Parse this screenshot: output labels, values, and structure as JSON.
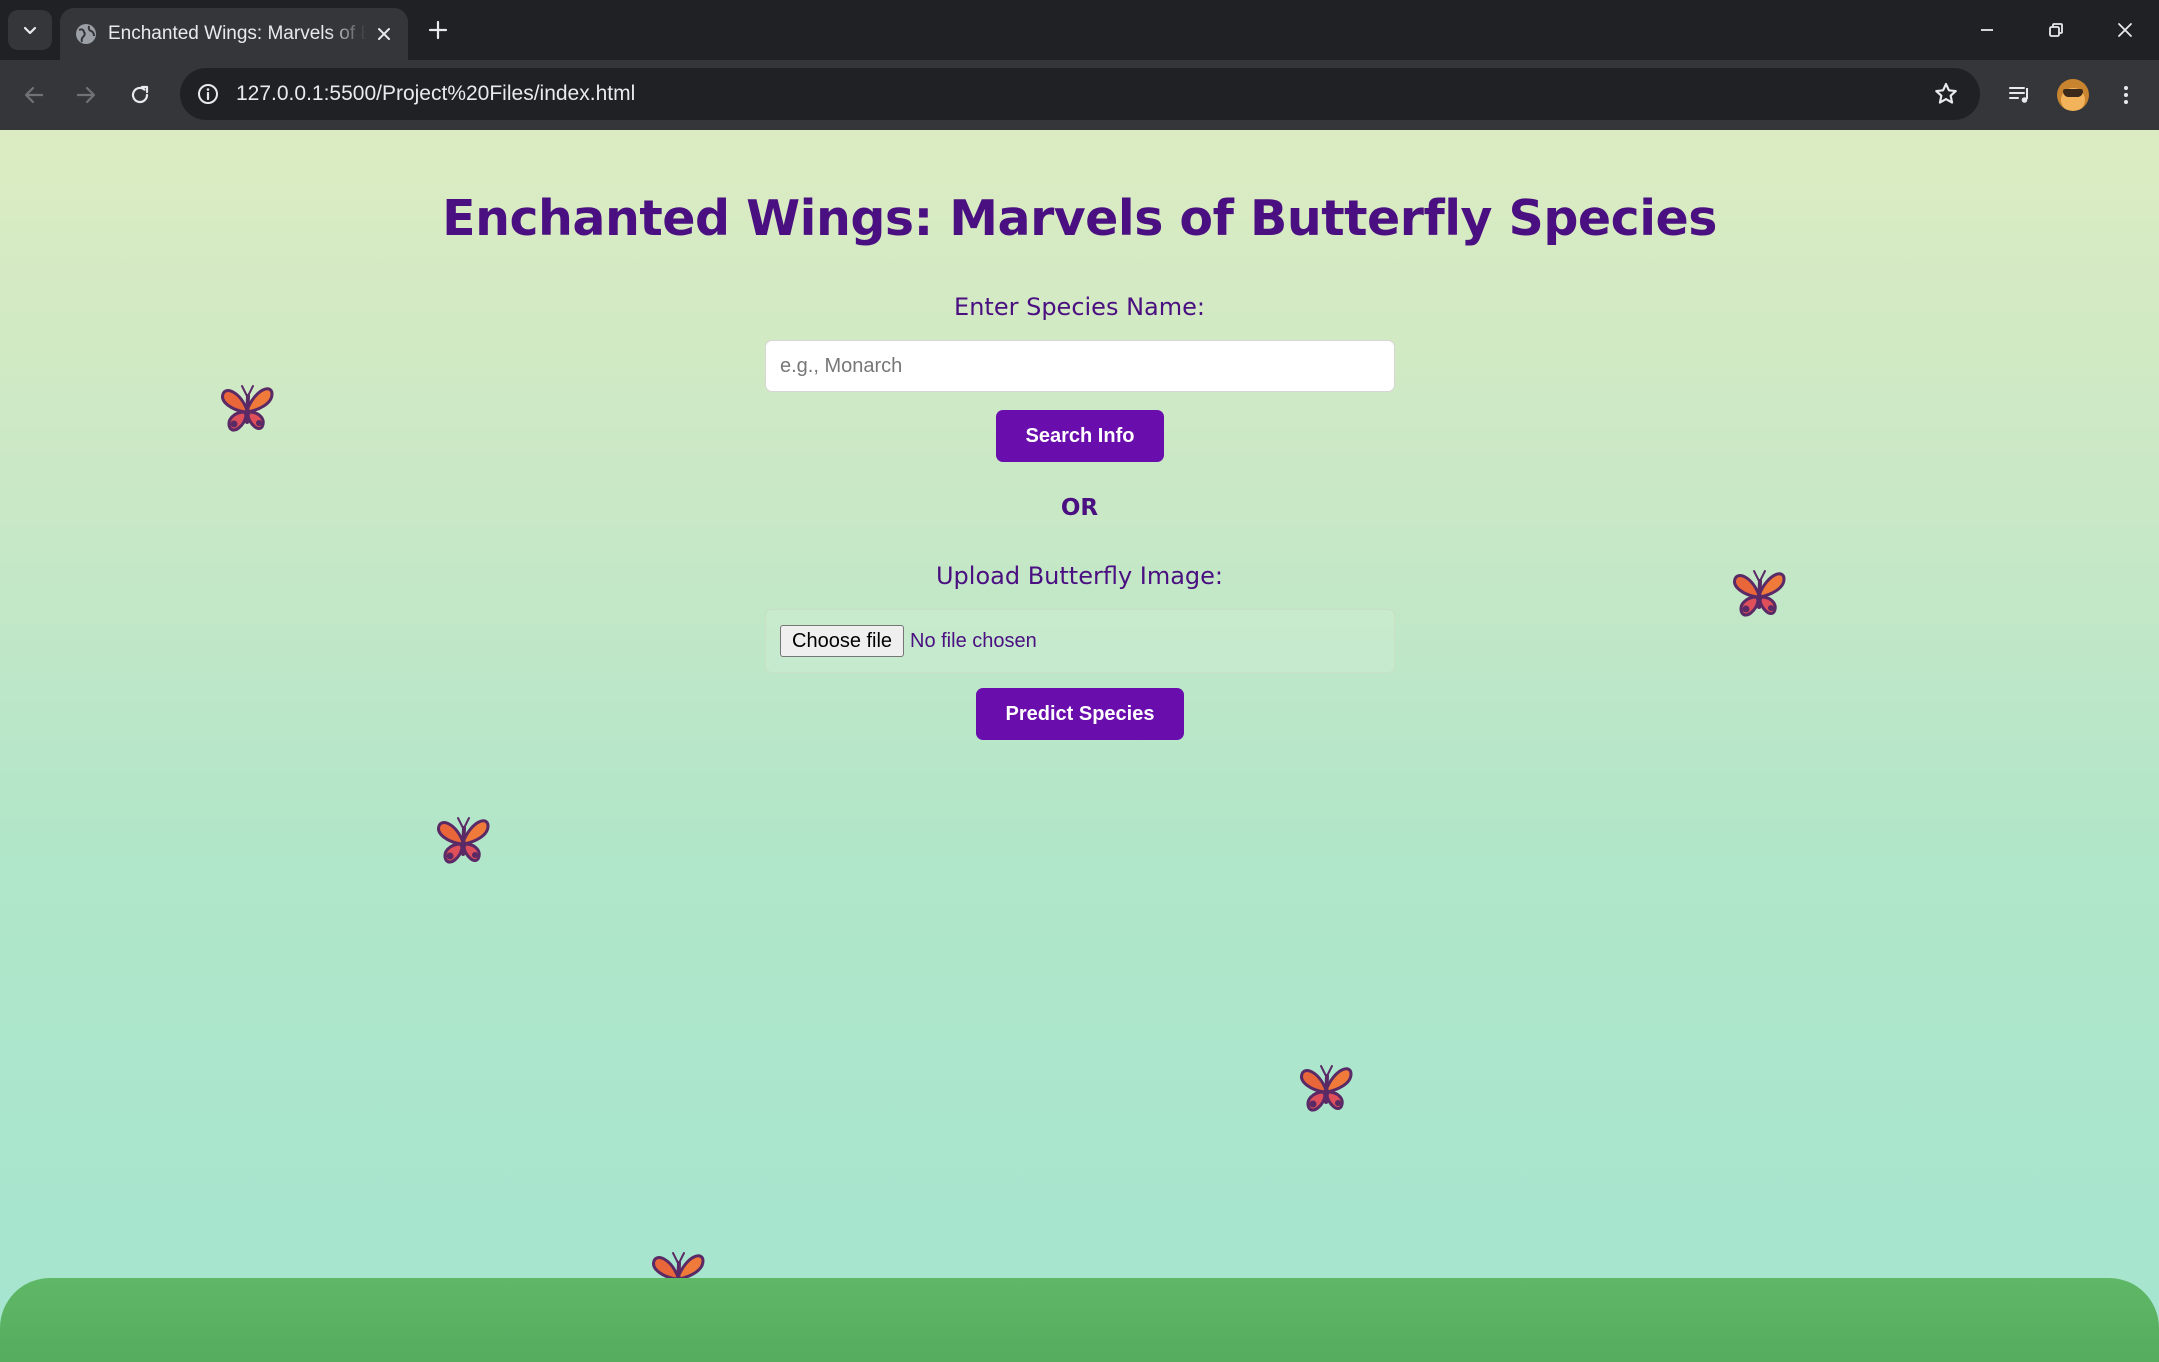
{
  "browser": {
    "tab": {
      "title": "Enchanted Wings: Marvels of Butterfly Species",
      "favicon": "globe-icon"
    },
    "address_bar": {
      "url": "127.0.0.1:5500/Project%20Files/index.html"
    },
    "icons": {
      "tab_search": "chevron-down-icon",
      "new_tab": "plus-icon",
      "minimize": "minimize-icon",
      "restore": "restore-icon",
      "close": "close-icon",
      "back": "arrow-left-icon",
      "forward": "arrow-right-icon",
      "reload": "reload-icon",
      "site_info": "info-icon",
      "bookmark": "star-icon",
      "media": "media-queue-icon",
      "profile": "avatar",
      "menu": "kebab-menu-icon"
    }
  },
  "page": {
    "title": "Enchanted Wings: Marvels of Butterfly Species",
    "species_label": "Enter Species Name:",
    "species_placeholder": "e.g., Monarch",
    "search_button": "Search Info",
    "or_text": "OR",
    "upload_label": "Upload Butterfly Image:",
    "choose_file_button": "Choose file",
    "file_status": "No file chosen",
    "predict_button": "Predict Species",
    "decoration": "butterfly-icon"
  },
  "colors": {
    "title": "#4a0f80",
    "button": "#6a0dad",
    "ground": "#5fb866",
    "background_top": "#dcecc2",
    "background_bottom": "#a5e5d0"
  }
}
